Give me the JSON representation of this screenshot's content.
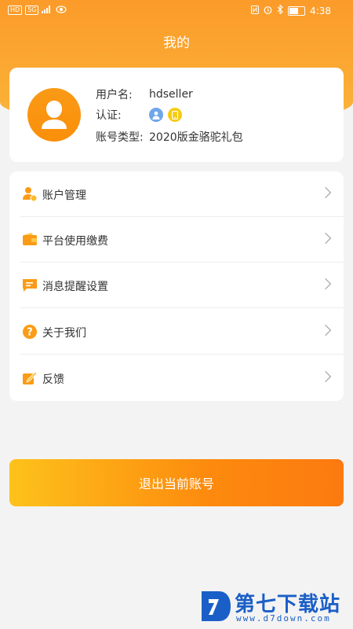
{
  "status_bar": {
    "left_badges": [
      "HD",
      "5G"
    ],
    "time": "4:38"
  },
  "header": {
    "title": "我的"
  },
  "profile": {
    "username_label": "用户名:",
    "username_value": "hdseller",
    "cert_label": "认证:",
    "cert_icons": [
      "person-cert-icon",
      "phone-cert-icon"
    ],
    "account_type_label": "账号类型:",
    "account_type_value": "2020版金骆驼礼包"
  },
  "menu": {
    "items": [
      {
        "label": "账户管理",
        "icon": "account-manage-icon"
      },
      {
        "label": "平台使用缴费",
        "icon": "wallet-icon"
      },
      {
        "label": "消息提醒设置",
        "icon": "message-icon"
      },
      {
        "label": "关于我们",
        "icon": "question-icon"
      },
      {
        "label": "反馈",
        "icon": "feedback-icon"
      }
    ]
  },
  "logout": {
    "label": "退出当前账号"
  },
  "watermark": {
    "text": "第七下载站",
    "url": "www.d7down.com"
  },
  "colors": {
    "brand_orange": "#fb9b2a",
    "button_start": "#fdc21b",
    "button_end": "#fc7a10"
  }
}
